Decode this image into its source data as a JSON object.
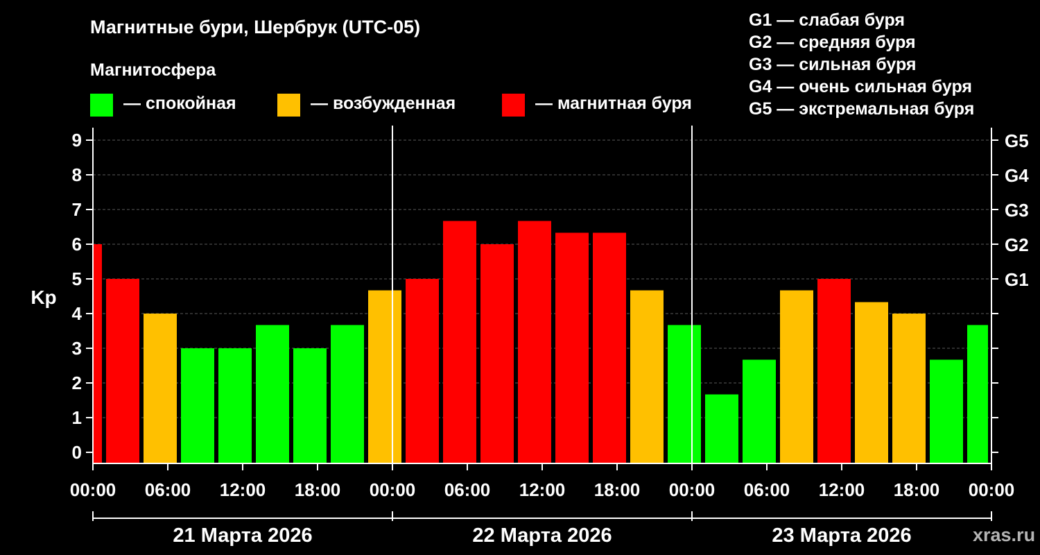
{
  "header": {
    "title": "Магнитные бури, Шербрук (UTC-05)",
    "subtitle": "Магнитосфера"
  },
  "legend": {
    "calm": {
      "label": "— спокойная",
      "color": "#00ff00"
    },
    "excited": {
      "label": "— возбужденная",
      "color": "#ffc000"
    },
    "storm": {
      "label": "— магнитная буря",
      "color": "#ff0000"
    }
  },
  "g_legend": [
    "G1 — слабая буря",
    "G2 — средняя буря",
    "G3 — сильная буря",
    "G4 — очень сильная буря",
    "G5 — экстремальная буря"
  ],
  "watermark": "xras.ru",
  "chart_data": {
    "type": "bar",
    "ylabel": "Kp",
    "ylim": [
      0,
      9
    ],
    "y_ticks": [
      "0",
      "1",
      "2",
      "3",
      "4",
      "5",
      "6",
      "7",
      "8",
      "9"
    ],
    "g_ticks": [
      {
        "kp": 5,
        "label": "G1"
      },
      {
        "kp": 6,
        "label": "G2"
      },
      {
        "kp": 7,
        "label": "G3"
      },
      {
        "kp": 8,
        "label": "G4"
      },
      {
        "kp": 9,
        "label": "G5"
      }
    ],
    "x_ticks": [
      "00:00",
      "06:00",
      "12:00",
      "18:00",
      "00:00",
      "06:00",
      "12:00",
      "18:00",
      "00:00",
      "06:00",
      "12:00",
      "18:00",
      "00:00"
    ],
    "days": [
      "21 Марта 2026",
      "22 Марта 2026",
      "23 Марта 2026"
    ],
    "grid": true,
    "colors": {
      "calm": "#00ff00",
      "excited": "#ffc000",
      "storm": "#ff0000"
    },
    "bars": [
      {
        "start_hour": 0,
        "end_hour": 1,
        "kp": 6.0,
        "level": "storm"
      },
      {
        "start_hour": 1,
        "end_hour": 4,
        "kp": 5.0,
        "level": "storm"
      },
      {
        "start_hour": 4,
        "end_hour": 7,
        "kp": 4.0,
        "level": "excited"
      },
      {
        "start_hour": 7,
        "end_hour": 10,
        "kp": 3.0,
        "level": "calm"
      },
      {
        "start_hour": 10,
        "end_hour": 13,
        "kp": 3.0,
        "level": "calm"
      },
      {
        "start_hour": 13,
        "end_hour": 16,
        "kp": 3.67,
        "level": "calm"
      },
      {
        "start_hour": 16,
        "end_hour": 19,
        "kp": 3.0,
        "level": "calm"
      },
      {
        "start_hour": 19,
        "end_hour": 22,
        "kp": 3.67,
        "level": "calm"
      },
      {
        "start_hour": 22,
        "end_hour": 25,
        "kp": 4.67,
        "level": "excited"
      },
      {
        "start_hour": 25,
        "end_hour": 28,
        "kp": 5.0,
        "level": "storm"
      },
      {
        "start_hour": 28,
        "end_hour": 31,
        "kp": 6.67,
        "level": "storm"
      },
      {
        "start_hour": 31,
        "end_hour": 34,
        "kp": 6.0,
        "level": "storm"
      },
      {
        "start_hour": 34,
        "end_hour": 37,
        "kp": 6.67,
        "level": "storm"
      },
      {
        "start_hour": 37,
        "end_hour": 40,
        "kp": 6.33,
        "level": "storm"
      },
      {
        "start_hour": 40,
        "end_hour": 43,
        "kp": 6.33,
        "level": "storm"
      },
      {
        "start_hour": 43,
        "end_hour": 46,
        "kp": 4.67,
        "level": "excited"
      },
      {
        "start_hour": 46,
        "end_hour": 49,
        "kp": 3.67,
        "level": "calm"
      },
      {
        "start_hour": 49,
        "end_hour": 52,
        "kp": 1.67,
        "level": "calm"
      },
      {
        "start_hour": 52,
        "end_hour": 55,
        "kp": 2.67,
        "level": "calm"
      },
      {
        "start_hour": 55,
        "end_hour": 58,
        "kp": 4.67,
        "level": "excited"
      },
      {
        "start_hour": 58,
        "end_hour": 61,
        "kp": 5.0,
        "level": "storm"
      },
      {
        "start_hour": 61,
        "end_hour": 64,
        "kp": 4.33,
        "level": "excited"
      },
      {
        "start_hour": 64,
        "end_hour": 67,
        "kp": 4.0,
        "level": "excited"
      },
      {
        "start_hour": 67,
        "end_hour": 70,
        "kp": 2.67,
        "level": "calm"
      },
      {
        "start_hour": 70,
        "end_hour": 72,
        "kp": 3.67,
        "level": "calm"
      }
    ]
  }
}
